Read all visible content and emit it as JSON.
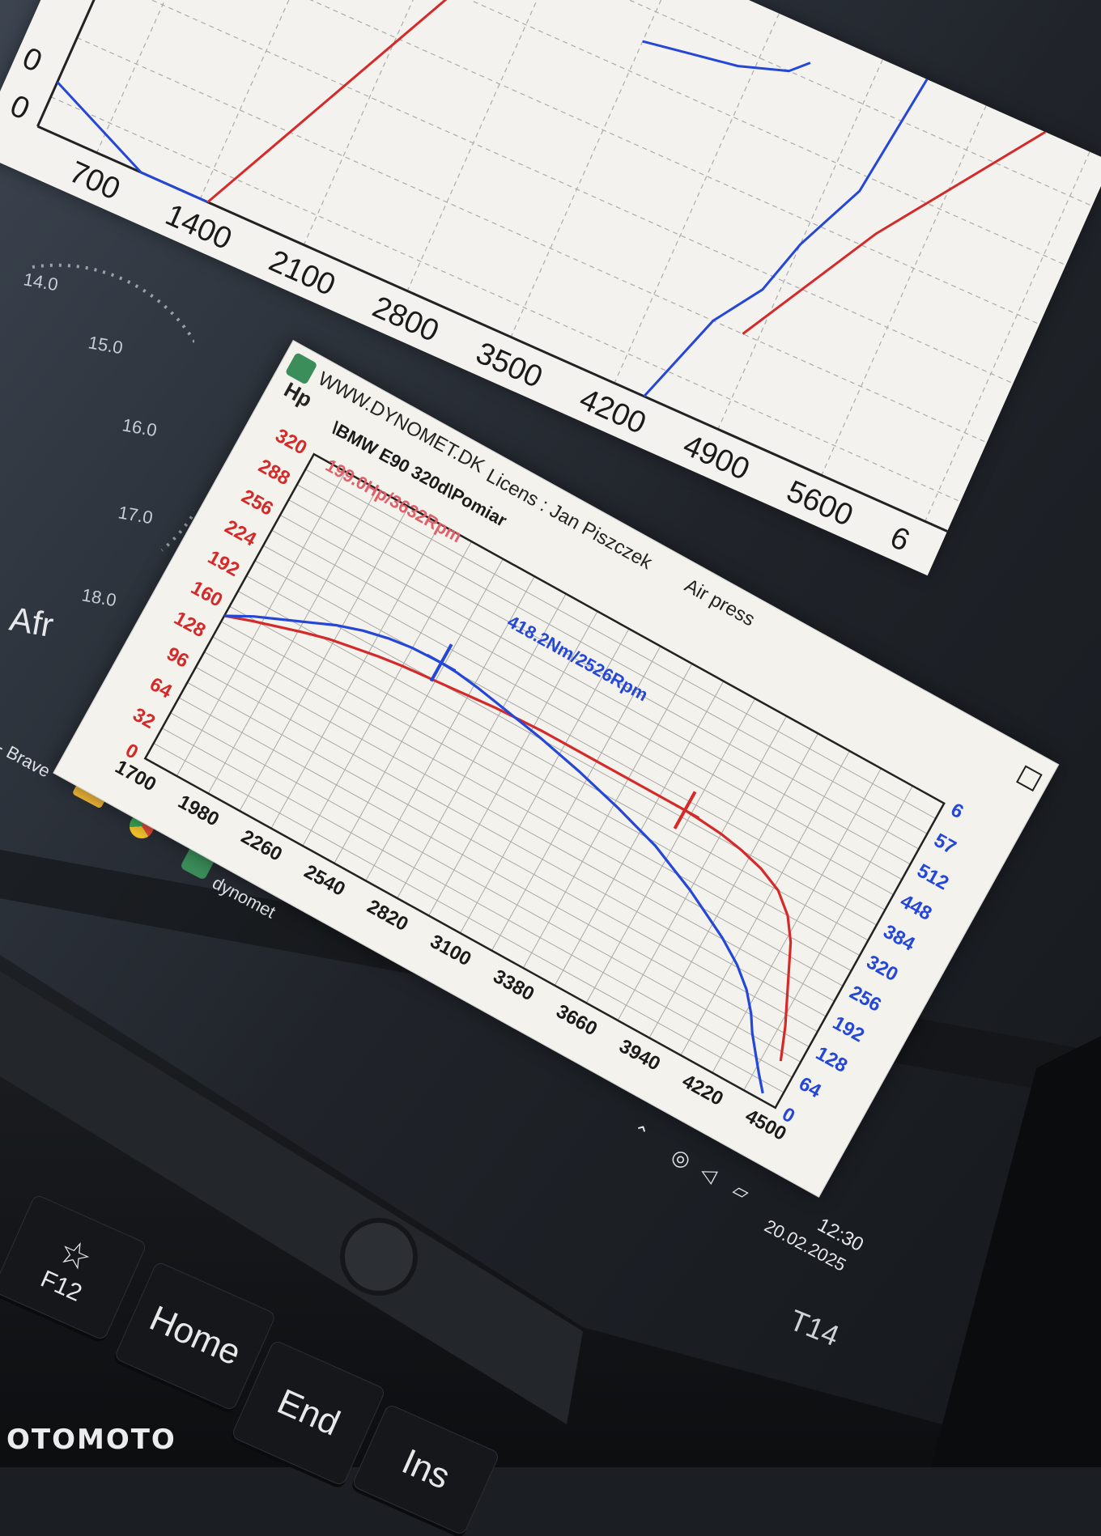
{
  "taskbar": {
    "brave_label": "i - Brave",
    "dynomet_label": "dynomet",
    "time": "12:30",
    "date": "20.02.2025"
  },
  "gauge": {
    "ticks": [
      "14.0",
      "15.0",
      "16.0",
      "17.0",
      "18.0"
    ],
    "label": "Afr"
  },
  "laptop": {
    "model": "T14"
  },
  "keyboard": {
    "f12": "F12",
    "home": "Home",
    "end": "End",
    "insert": "Ins"
  },
  "watermark": "OTOMOTO",
  "bg_chart": {
    "x_ticks": [
      "700",
      "1400",
      "2100",
      "2800",
      "3500",
      "4200",
      "4900",
      "5600",
      "6"
    ],
    "y_ticks": [
      "0",
      "0"
    ]
  },
  "window": {
    "title": "WWW.DYNOMET.DK",
    "subtitle_path": "\\BMW E90 320d\\Pomiar",
    "licens": "Licens : Jan Piszczek",
    "extra": "Air press"
  },
  "chart_data": {
    "type": "line",
    "x_ticks": [
      "1700",
      "1980",
      "2260",
      "2540",
      "2820",
      "3100",
      "3380",
      "3660",
      "3940",
      "4220",
      "4500"
    ],
    "xlim": [
      1700,
      4500
    ],
    "left_axis": {
      "unit": "Hp",
      "ticks": [
        "0",
        "32",
        "64",
        "96",
        "128",
        "160",
        "192",
        "224",
        "256",
        "288",
        "320"
      ],
      "range": [
        0,
        320
      ],
      "color": "#d42a2a"
    },
    "right_axis": {
      "ticks": [
        "0",
        "64",
        "128",
        "192",
        "256",
        "320",
        "384",
        "448",
        "512",
        "57",
        "6"
      ],
      "range": [
        0,
        640
      ],
      "color": "#2447d8"
    },
    "annotations": [
      {
        "text": "199.0Hp/3632Rpm",
        "color": "#e0606a"
      },
      {
        "text": "418.2Nm/2526Rpm",
        "color": "#2447d8"
      }
    ],
    "series": [
      {
        "color": "#d42a2a",
        "axis": "left",
        "points": [
          [
            1700,
            150
          ],
          [
            1800,
            158
          ],
          [
            1900,
            165
          ],
          [
            2000,
            172
          ],
          [
            2100,
            178
          ],
          [
            2200,
            182
          ],
          [
            2300,
            186
          ],
          [
            2400,
            189
          ],
          [
            2500,
            191
          ],
          [
            2600,
            193
          ],
          [
            2700,
            195
          ],
          [
            2800,
            197
          ],
          [
            2900,
            198
          ],
          [
            3000,
            199
          ],
          [
            3100,
            199
          ],
          [
            3200,
            199
          ],
          [
            3300,
            199
          ],
          [
            3400,
            199
          ],
          [
            3500,
            199
          ],
          [
            3632,
            199
          ],
          [
            3700,
            198
          ],
          [
            3800,
            196
          ],
          [
            3900,
            192
          ],
          [
            4000,
            186
          ],
          [
            4100,
            176
          ],
          [
            4180,
            160
          ],
          [
            4240,
            140
          ],
          [
            4280,
            120
          ],
          [
            4320,
            100
          ],
          [
            4380,
            70
          ],
          [
            4430,
            40
          ]
        ]
      },
      {
        "color": "#2447d8",
        "axis": "right",
        "points": [
          [
            1700,
            300
          ],
          [
            1800,
            325
          ],
          [
            1900,
            345
          ],
          [
            2000,
            365
          ],
          [
            2100,
            385
          ],
          [
            2200,
            400
          ],
          [
            2300,
            410
          ],
          [
            2400,
            416
          ],
          [
            2526,
            418
          ],
          [
            2600,
            416
          ],
          [
            2700,
            410
          ],
          [
            2800,
            402
          ],
          [
            2900,
            394
          ],
          [
            3000,
            386
          ],
          [
            3100,
            376
          ],
          [
            3200,
            366
          ],
          [
            3300,
            354
          ],
          [
            3400,
            342
          ],
          [
            3500,
            328
          ],
          [
            3600,
            314
          ],
          [
            3700,
            294
          ],
          [
            3800,
            274
          ],
          [
            3900,
            250
          ],
          [
            4000,
            226
          ],
          [
            4100,
            196
          ],
          [
            4180,
            164
          ],
          [
            4240,
            130
          ],
          [
            4280,
            100
          ],
          [
            4330,
            70
          ],
          [
            4380,
            40
          ],
          [
            4430,
            12
          ]
        ]
      }
    ],
    "cursors": [
      {
        "x": 2526,
        "color": "#2447d8"
      },
      {
        "x": 3632,
        "color": "#d42a2a"
      }
    ]
  }
}
